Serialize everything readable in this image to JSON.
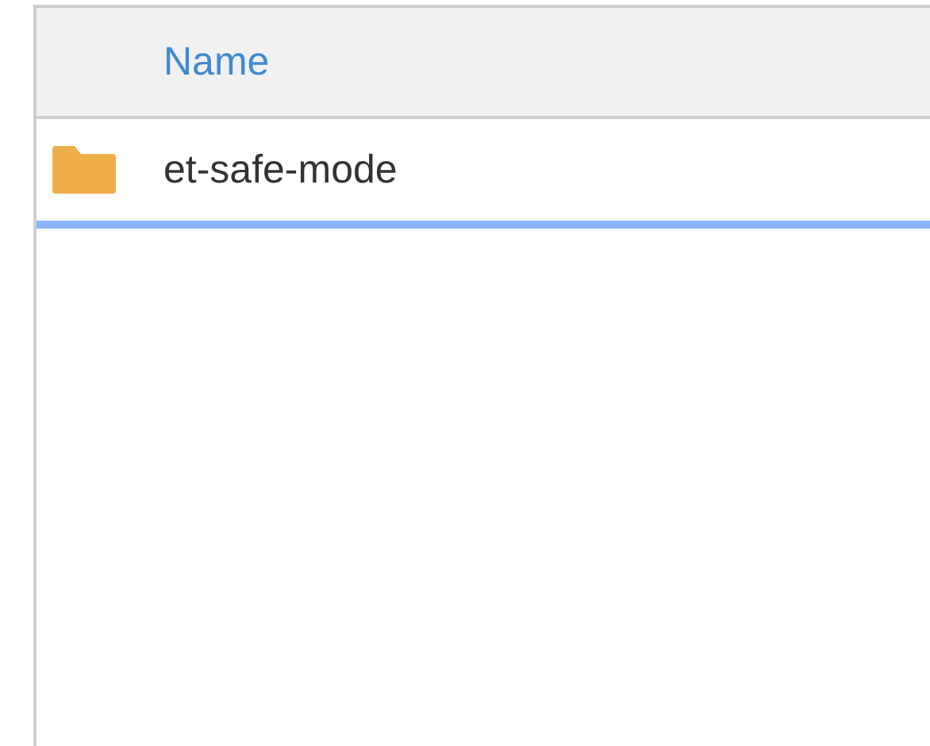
{
  "table": {
    "columns": [
      {
        "label": "Name"
      }
    ],
    "rows": [
      {
        "name": "et-safe-mode",
        "kind": "folder",
        "selected": true
      }
    ]
  }
}
